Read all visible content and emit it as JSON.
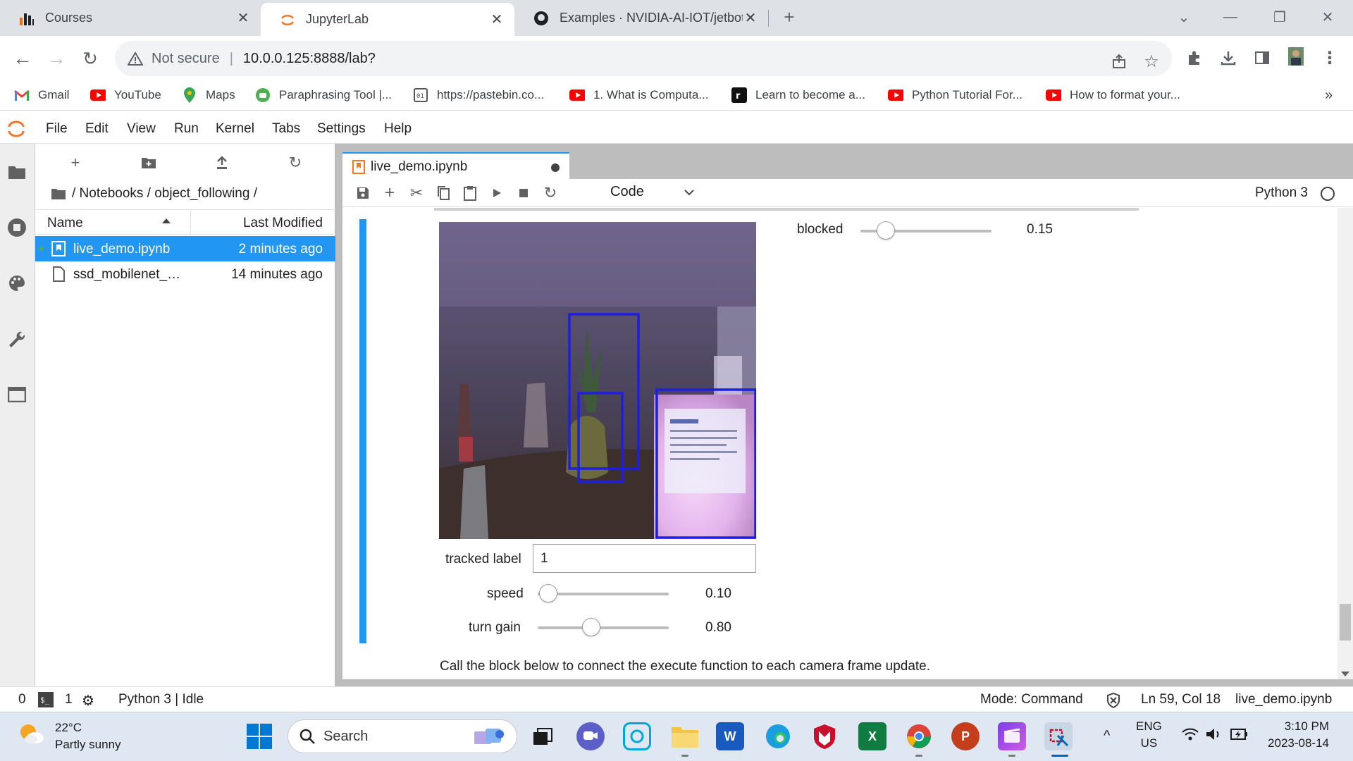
{
  "browser": {
    "tabs": [
      {
        "title": "Courses"
      },
      {
        "title": "JupyterLab"
      },
      {
        "title": "Examples · NVIDIA-AI-IOT/jetbot"
      }
    ],
    "address": {
      "security": "Not secure",
      "url": "10.0.0.125:8888/lab?"
    },
    "bookmarks": [
      {
        "label": "Gmail",
        "icon": "gmail-icon"
      },
      {
        "label": "YouTube",
        "icon": "youtube-icon"
      },
      {
        "label": "Maps",
        "icon": "maps-icon"
      },
      {
        "label": "Paraphrasing Tool |...",
        "icon": "paraphrase-icon"
      },
      {
        "label": "https://pastebin.co...",
        "icon": "pastebin-icon"
      },
      {
        "label": "1. What is Computa...",
        "icon": "youtube-icon"
      },
      {
        "label": "Learn to become a...",
        "icon": "r-icon"
      },
      {
        "label": "Python Tutorial For...",
        "icon": "youtube-icon"
      },
      {
        "label": "How to format your...",
        "icon": "youtube-icon"
      }
    ],
    "more_bookmarks": "»"
  },
  "jupyter": {
    "menu": [
      "File",
      "Edit",
      "View",
      "Run",
      "Kernel",
      "Tabs",
      "Settings",
      "Help"
    ],
    "filebrowser": {
      "breadcrumb": "/ Notebooks / object_following /",
      "col_name": "Name",
      "col_modified": "Last Modified",
      "files": [
        {
          "name": "live_demo.ipynb",
          "modified": "2 minutes ago",
          "selected": true
        },
        {
          "name": "ssd_mobilenet_v...",
          "modified": "14 minutes ago",
          "selected": false
        }
      ]
    },
    "doc_tab": "live_demo.ipynb",
    "toolbar": {
      "cell_type": "Code",
      "kernel": "Python 3"
    },
    "widgets": {
      "blocked": {
        "label": "blocked",
        "value": "0.15",
        "fraction": 0.15
      },
      "tracked_label": {
        "label": "tracked label",
        "value": "1"
      },
      "speed": {
        "label": "speed",
        "value": "0.10",
        "fraction": 0.1
      },
      "turn_gain": {
        "label": "turn gain",
        "value": "0.80",
        "fraction": 0.4
      }
    },
    "markdown": "Call the block below to connect the execute function to each camera frame update.",
    "status": {
      "count_a": "0",
      "count_b": "1",
      "kernel_state": "Python 3 | Idle",
      "mode": "Mode: Command",
      "position": "Ln 59, Col 18",
      "filename": "live_demo.ipynb"
    }
  },
  "taskbar": {
    "weather": {
      "temp": "22°C",
      "desc": "Partly sunny"
    },
    "search": "Search",
    "lang": {
      "line1": "ENG",
      "line2": "US"
    },
    "clock": {
      "time": "3:10 PM",
      "date": "2023-08-14"
    }
  },
  "colors": {
    "accent": "#2196f3",
    "jupyter_orange": "#f37726",
    "detection_box": "#1e1ee0"
  }
}
